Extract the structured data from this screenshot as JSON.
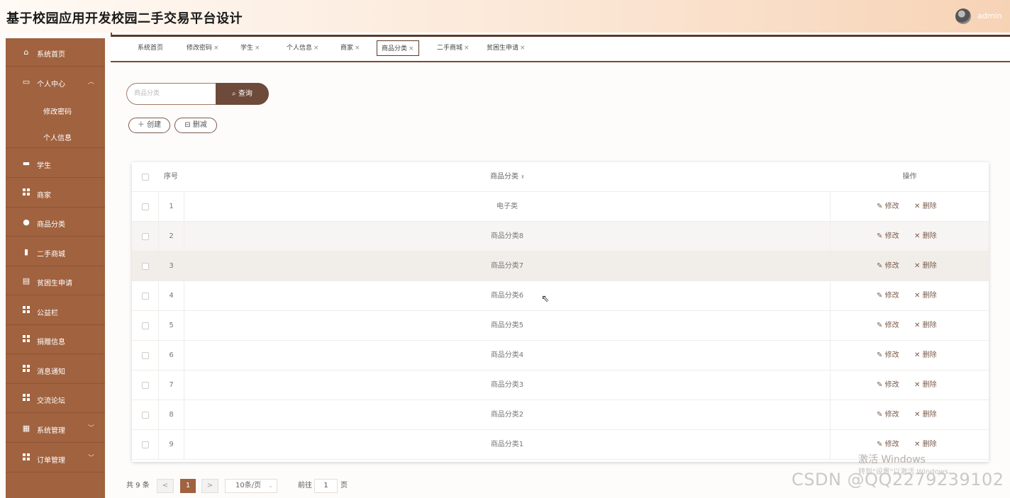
{
  "header": {
    "title": "基于校园应用开发校园二手交易平台设计",
    "user": "admin"
  },
  "sidebar": {
    "items": [
      {
        "label": "系统首页",
        "icon": "home-icon"
      },
      {
        "label": "个人中心",
        "icon": "card-icon"
      },
      {
        "label": "学生",
        "icon": "briefcase-icon"
      },
      {
        "label": "商家",
        "icon": "grid-icon"
      },
      {
        "label": "商品分类",
        "icon": "user-icon"
      },
      {
        "label": "二手商城",
        "icon": "book-icon"
      },
      {
        "label": "贫困生申请",
        "icon": "clipboard-icon"
      },
      {
        "label": "公益栏",
        "icon": "grid-icon"
      },
      {
        "label": "捐赠信息",
        "icon": "grid-icon"
      },
      {
        "label": "消息通知",
        "icon": "grid-icon"
      },
      {
        "label": "交流论坛",
        "icon": "grid-icon"
      },
      {
        "label": "系统管理",
        "icon": "chart-icon"
      },
      {
        "label": "订单管理",
        "icon": "grid-icon"
      }
    ],
    "sub_items": [
      "修改密码",
      "个人信息"
    ]
  },
  "tabs": [
    {
      "label": "系统首页",
      "close": ""
    },
    {
      "label": "修改密码",
      "close": "×"
    },
    {
      "label": "学生",
      "close": "×"
    },
    {
      "label": "个人信息",
      "close": "×"
    },
    {
      "label": "商家",
      "close": "×"
    },
    {
      "label": "商品分类",
      "close": "×"
    },
    {
      "label": "二手商城",
      "close": "×"
    },
    {
      "label": "贫困生申请",
      "close": "×"
    }
  ],
  "search": {
    "placeholder": "商品分类",
    "button": "查询"
  },
  "actions": {
    "create": "创建",
    "delete": "删减"
  },
  "table": {
    "headers": {
      "index": "序号",
      "name": "商品分类",
      "ops": "操作"
    },
    "rows": [
      {
        "index": "1",
        "name": "电子类"
      },
      {
        "index": "2",
        "name": "商品分类8"
      },
      {
        "index": "3",
        "name": "商品分类7"
      },
      {
        "index": "4",
        "name": "商品分类6"
      },
      {
        "index": "5",
        "name": "商品分类5"
      },
      {
        "index": "6",
        "name": "商品分类4"
      },
      {
        "index": "7",
        "name": "商品分类3"
      },
      {
        "index": "8",
        "name": "商品分类2"
      },
      {
        "index": "9",
        "name": "商品分类1"
      }
    ],
    "edit_label": "修改",
    "delete_label": "删除"
  },
  "pagination": {
    "total": "共 9 条",
    "prev": "<",
    "current": "1",
    "next": ">",
    "page_size": "10条/页",
    "goto_prefix": "前往",
    "goto_value": "1",
    "goto_suffix": "页"
  },
  "overlay": {
    "activate_title": "激活 Windows",
    "activate_sub": "转到\"设置\"以激活 Windows。",
    "csdn": "CSDN @QQ2279239102"
  },
  "colors": {
    "sidebar": "#a0623f",
    "accent": "#6e4a3a",
    "edit": "#7a5a4a"
  }
}
